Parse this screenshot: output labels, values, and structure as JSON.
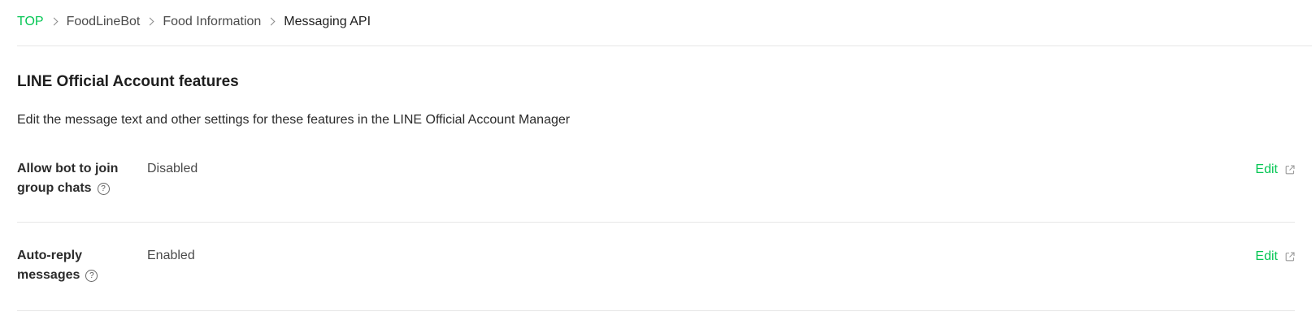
{
  "breadcrumb": {
    "items": [
      "TOP",
      "FoodLineBot",
      "Food Information",
      "Messaging API"
    ]
  },
  "section": {
    "title": "LINE Official Account features",
    "description": "Edit the message text and other settings for these features in the LINE Official Account Manager"
  },
  "features": [
    {
      "label": "Allow bot to join group chats",
      "value": "Disabled",
      "edit_label": "Edit"
    },
    {
      "label": "Auto-reply messages",
      "value": "Enabled",
      "edit_label": "Edit"
    }
  ],
  "icons": {
    "help": "question-circle-icon",
    "external": "external-link-icon",
    "separator": "chevron-right-icon"
  },
  "colors": {
    "accent": "#06c755",
    "text": "#1e1e1e",
    "muted": "#4a4a4a",
    "divider": "#e6e6e6"
  }
}
